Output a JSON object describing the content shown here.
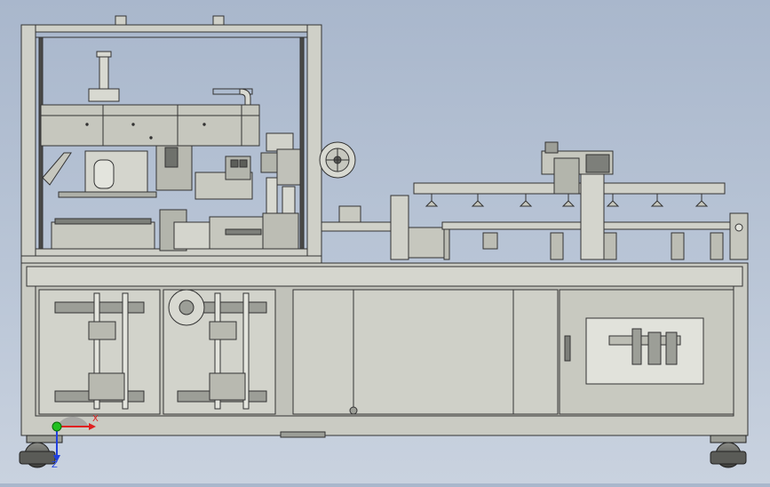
{
  "viewport": {
    "model": "packaging-machine-assembly",
    "view": "front"
  },
  "triad": {
    "x_label": "X",
    "z_label": "Z",
    "x_color": "#e02020",
    "z_color": "#2040e0",
    "origin_color": "#20c020"
  },
  "colors": {
    "frame_fill": "#cfd0c8",
    "frame_stroke": "#3a3a3a",
    "panel_fill": "#c8c9c0",
    "dark_fill": "#7d7f7a",
    "light_fill": "#e3e4dd"
  }
}
